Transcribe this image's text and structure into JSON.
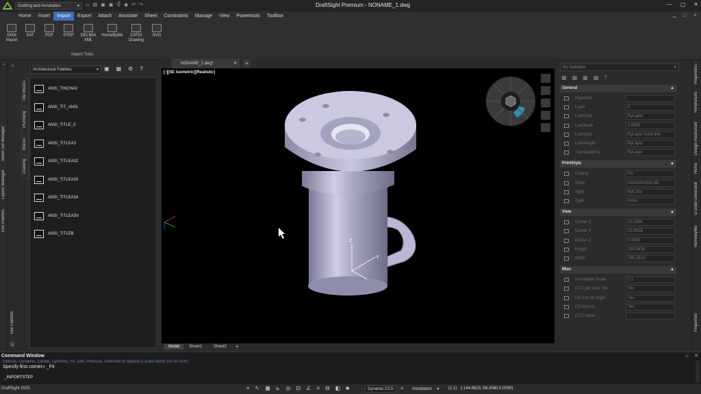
{
  "app": {
    "workspace": "Drafting and Annotation",
    "title": "DraftSight Premium - NONAME_1.dwg",
    "product": "DraftSight 2025"
  },
  "menu": [
    "Home",
    "Insert",
    "Import",
    "Export",
    "Attach",
    "Annotate",
    "Sheet",
    "Constraints",
    "Manage",
    "View",
    "Powertools",
    "Toolbox"
  ],
  "menu_active": "Import",
  "ribbon": {
    "buttons": [
      {
        "label": "DGN\nImport"
      },
      {
        "label": "SAT"
      },
      {
        "label": "PDF"
      },
      {
        "label": "STEP"
      },
      {
        "label": "DELMIA\nXML"
      },
      {
        "label": "HomeByMe"
      },
      {
        "label": "CATIA\nDrawing"
      },
      {
        "label": "SVG"
      }
    ],
    "group": "Import Tools"
  },
  "left_strip": [
    "Sheet Set Manager",
    "Layers Manager",
    "Tool Palettes"
  ],
  "left_strip_bottom": "Tool Palettes",
  "palette": {
    "dropdown": "Architectural Palettes",
    "side_tabs": [
      "Title Blocks",
      "Plumbing",
      "Blocks",
      "Drawing"
    ],
    "items": [
      "ANSI_TINCHA3",
      "ANSI_TIT_ANSI",
      "ANSI_TITLE_C",
      "ANSI_TITLEA3",
      "ANSI_TITLEA32",
      "ANSI_TITLEA33",
      "ANSI_TITLEA34",
      "ANSI_TITLEA3V",
      "ANSI_TITLEB"
    ]
  },
  "doc_tab": "NONAME_1.dwg*",
  "viewport_label": "[-][SE Isometric][Realistic]",
  "sheet_tabs": [
    "Model",
    "Sheet1",
    "Sheet2"
  ],
  "properties": {
    "selection": "No Selection",
    "sections": [
      {
        "title": "General",
        "rows": [
          {
            "name": "Hyperlink",
            "value": ""
          },
          {
            "name": "Layer",
            "value": "0"
          },
          {
            "name": "LineColor",
            "value": "ByLayer"
          },
          {
            "name": "LineScale",
            "value": "1.0000"
          },
          {
            "name": "LineStyle",
            "value": "ByLayer     Solid line"
          },
          {
            "name": "LineWeight",
            "value": "ByLayer"
          },
          {
            "name": "Transparency",
            "value": "ByLayer"
          }
        ]
      },
      {
        "title": "PrintStyle",
        "rows": [
          {
            "name": "Display",
            "value": "No"
          },
          {
            "name": "Table",
            "value": "monochrome.ctb"
          },
          {
            "name": "Style",
            "value": "ByColor"
          },
          {
            "name": "Type",
            "value": "None"
          }
        ]
      },
      {
        "title": "View",
        "rows": [
          {
            "name": "Center X",
            "value": "10.2836"
          },
          {
            "name": "Center Y",
            "value": "25.9416"
          },
          {
            "name": "Center Z",
            "value": "0.0000"
          },
          {
            "name": "Height",
            "value": "193.5836"
          },
          {
            "name": "Width",
            "value": "295.2914"
          }
        ]
      },
      {
        "title": "Misc",
        "rows": [
          {
            "name": "Annotation Scale",
            "value": "1:1"
          },
          {
            "name": "CCS per view Tile",
            "value": "Yes"
          },
          {
            "name": "CS icon at origin",
            "value": "Yes"
          },
          {
            "name": "CS icon on",
            "value": "Yes"
          },
          {
            "name": "CCS name",
            "value": ""
          }
        ]
      }
    ]
  },
  "right_strip": [
    "Properties",
    "References",
    "Design Resources",
    "Home",
    "G-code Generator",
    "HomeByMe"
  ],
  "right_strip_bottom": "Properties",
  "command": {
    "title": "Command Window",
    "line1": "Options: Dynamic, Center, Dynamic, Fit, Left, Previous, Selected or Specify a scale factor (nX or nXP)",
    "line2": "Specify first corner» _Fit",
    "input": "_IMPORTSTEP"
  },
  "status": {
    "ccs": "Dynamic CCS",
    "annotation": "Annotation",
    "scale": "(1:1)",
    "coords": "(-144.8623,-56.3080,0.0000)"
  }
}
